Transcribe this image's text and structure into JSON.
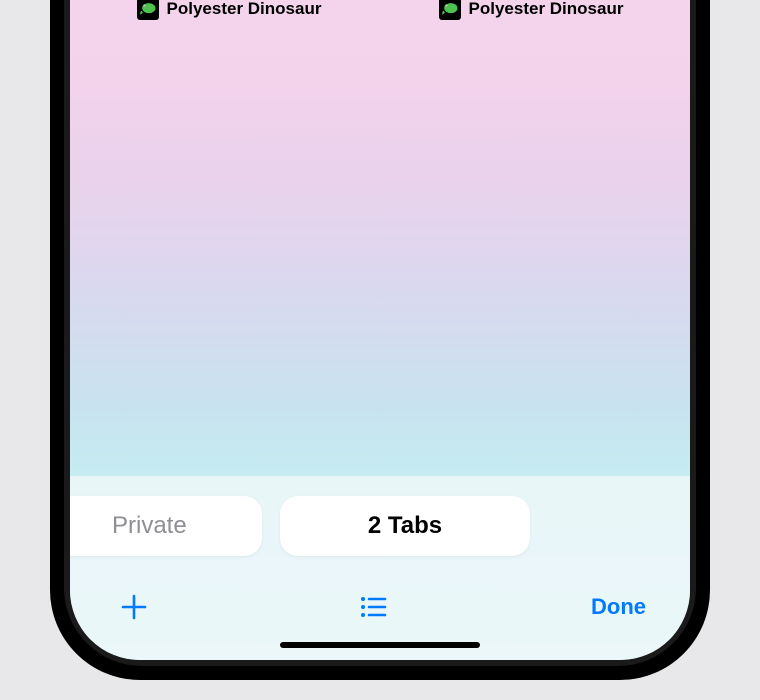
{
  "tabs": [
    {
      "title": "Polyester Dinosaur",
      "favicon": "dinosaur-icon"
    },
    {
      "title": "Polyester Dinosaur",
      "favicon": "dinosaur-icon"
    }
  ],
  "tab_groups": {
    "private_label": "Private",
    "current_label": "2 Tabs"
  },
  "toolbar": {
    "new_tab": "+",
    "done_label": "Done"
  },
  "colors": {
    "accent": "#007aff",
    "muted": "#8e8e93"
  }
}
